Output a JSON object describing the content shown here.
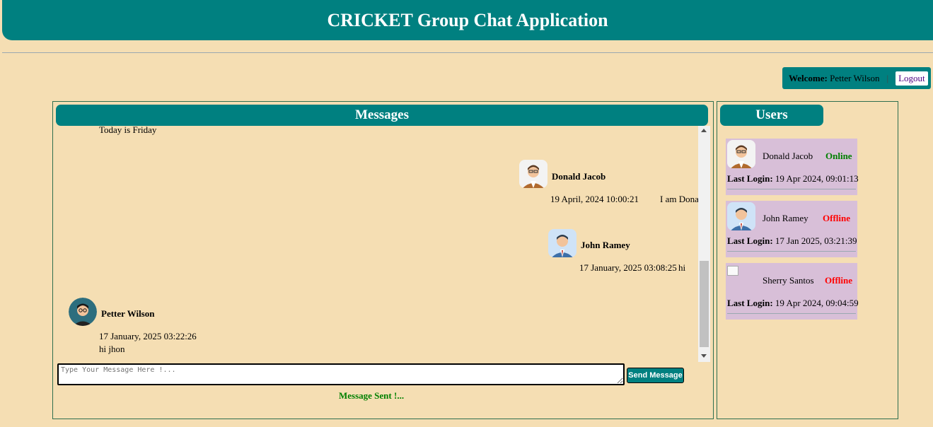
{
  "header": {
    "title": "CRICKET Group Chat Application"
  },
  "welcome": {
    "label": "Welcome:",
    "user": "Petter Wilson",
    "separator": "|",
    "logout_label": "Logout"
  },
  "messages_panel": {
    "title": "Messages",
    "messages": [
      {
        "sender": "",
        "timestamp": "",
        "text": "Today is Friday"
      },
      {
        "sender": "Donald Jacob",
        "timestamp": "19 April, 2024 10:00:21",
        "text": "I am Donald"
      },
      {
        "sender": "John Ramey",
        "timestamp": "17 January, 2025 03:08:25",
        "text": "hi"
      },
      {
        "sender": "Petter Wilson",
        "timestamp": "17 January, 2025 03:22:26",
        "text": "hi jhon"
      }
    ],
    "input": {
      "placeholder": "Type Your Message Here !...",
      "value": ""
    },
    "send_label": "Send Message",
    "status": "Message Sent !..."
  },
  "users_panel": {
    "title": "Users",
    "last_login_label": "Last Login:",
    "users": [
      {
        "name": "Donald Jacob",
        "status": "Online",
        "last_login": "19 Apr 2024, 09:01:13",
        "status_color": "#008000"
      },
      {
        "name": "John Ramey",
        "status": "Offline",
        "last_login": "17 Jan 2025, 03:21:39",
        "status_color": "#ff0000"
      },
      {
        "name": "Sherry Santos",
        "status": "Offline",
        "last_login": "19 Apr 2024, 09:04:59",
        "status_color": "#ff0000"
      }
    ]
  },
  "colors": {
    "background": "#f5deb3",
    "accent": "#008080",
    "card": "#d8bfd8",
    "online": "#008000",
    "offline": "#ff0000"
  }
}
